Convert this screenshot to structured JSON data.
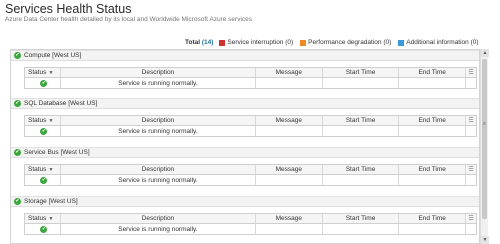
{
  "page": {
    "title": "Services Health Status",
    "subtitle": "Azure Data Center health detailed by its local and Worldwide Microsoft Azure services"
  },
  "summary": {
    "total_label": "Total",
    "total_count": "(14)",
    "legend": [
      {
        "label": "Service interruption (0)",
        "color": "#cc3333"
      },
      {
        "label": "Performance degradation (0)",
        "color": "#f08a24"
      },
      {
        "label": "Additional information (0)",
        "color": "#3b9bd8"
      }
    ]
  },
  "columns": {
    "status": "Status",
    "description": "Description",
    "message": "Message",
    "start_time": "Start Time",
    "end_time": "End Time"
  },
  "services": [
    {
      "name": "Compute [West US]",
      "rows": [
        {
          "description": "Service is running normally.",
          "message": "",
          "start_time": "",
          "end_time": ""
        }
      ]
    },
    {
      "name": "SQL Database [West US]",
      "rows": [
        {
          "description": "Service is running normally.",
          "message": "",
          "start_time": "",
          "end_time": ""
        }
      ]
    },
    {
      "name": "Service Bus [West US]",
      "rows": [
        {
          "description": "Service is running normally.",
          "message": "",
          "start_time": "",
          "end_time": ""
        }
      ]
    },
    {
      "name": "Storage [West US]",
      "rows": [
        {
          "description": "Service is running normally.",
          "message": "",
          "start_time": "",
          "end_time": ""
        }
      ]
    }
  ],
  "icons": {
    "ok": "check-circle-icon",
    "sort": "sort-down-icon",
    "column_menu": "column-menu-icon"
  },
  "colors": {
    "ok": "#3aa73a",
    "link": "#1a6fa3"
  }
}
